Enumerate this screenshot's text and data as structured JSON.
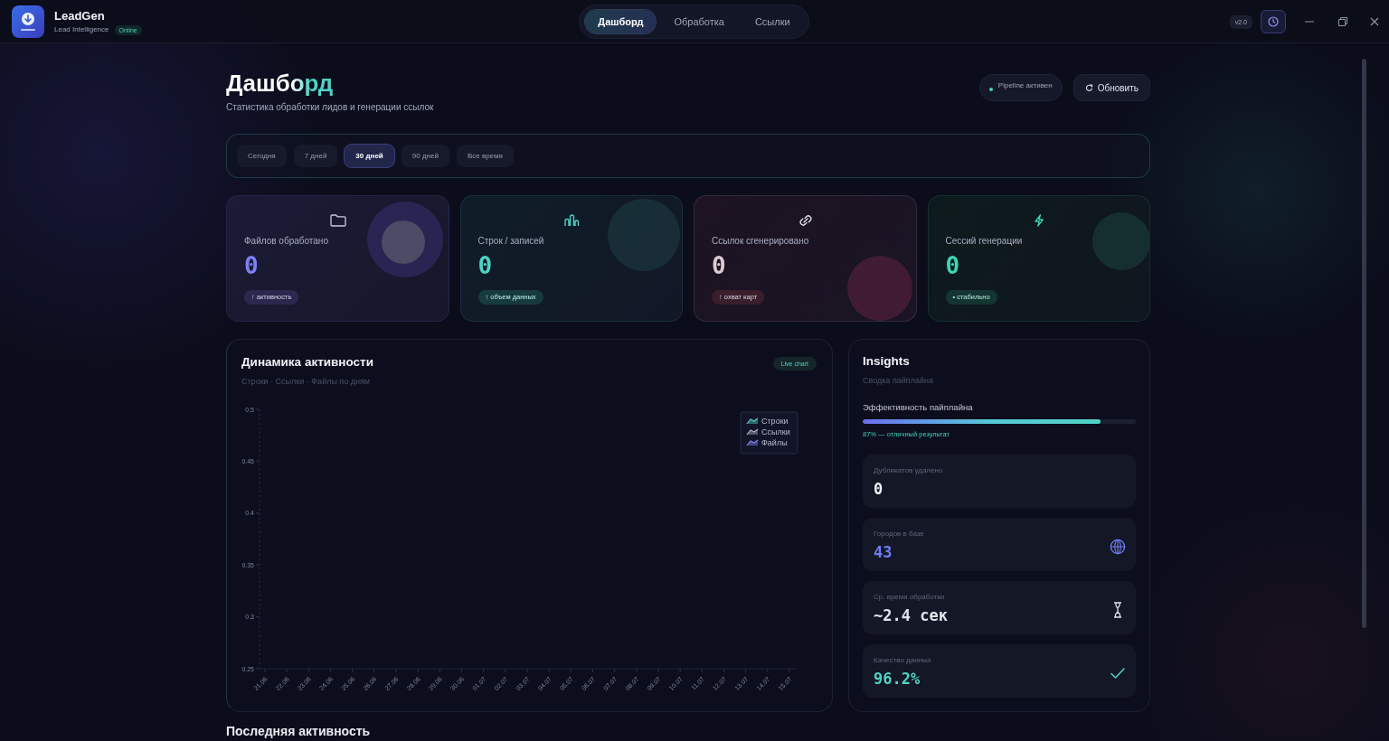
{
  "app": {
    "name": "LeadGen",
    "tagline": "Lead Intelligence",
    "status": "Online",
    "version": "v2.0"
  },
  "nav_tabs": [
    {
      "label": "Дашборд",
      "selected": true
    },
    {
      "label": "Обработка",
      "selected": false
    },
    {
      "label": "Ссылки",
      "selected": false
    }
  ],
  "header": {
    "title": "Дашборд",
    "subtitle": "Статистика обработки лидов и генерации ссылок",
    "pipeline_status": "Pipeline активен",
    "refresh_button": "Обновить"
  },
  "periods": [
    {
      "label": "Сегодня",
      "selected": false
    },
    {
      "label": "7 дней",
      "selected": false
    },
    {
      "label": "30 дней",
      "selected": true
    },
    {
      "label": "90 дней",
      "selected": false
    },
    {
      "label": "Все время",
      "selected": false
    }
  ],
  "stats": [
    {
      "kind": "folder",
      "label": "Файлов обработано",
      "value": "0",
      "badge": "↑ активность",
      "color": "#7c82f4"
    },
    {
      "kind": "bars",
      "label": "Строк / записей",
      "value": "0",
      "badge": "↑ объем данных",
      "color": "#4fd1c5"
    },
    {
      "kind": "link",
      "label": "Ссылок сгенерировано",
      "value": "0",
      "badge": "↑ охват карт",
      "color": "#dccbd5"
    },
    {
      "kind": "bolt",
      "label": "Сессий генерации",
      "value": "0",
      "badge": "• стабильно",
      "color": "#3fd3b4"
    }
  ],
  "chart": {
    "title": "Динамика активности",
    "subtitle": "Строки · Ссылки · Файлы по дням",
    "badge": "Live chart",
    "chart_data": {
      "type": "line",
      "categories": [
        "21.06",
        "22.06",
        "23.06",
        "24.06",
        "25.06",
        "26.06",
        "27.06",
        "28.06",
        "29.06",
        "30.06",
        "01.07",
        "02.07",
        "03.07",
        "04.07",
        "05.07",
        "06.07",
        "07.07",
        "08.07",
        "09.07",
        "10.07",
        "11.07",
        "12.07",
        "13.07",
        "14.07",
        "15.07"
      ],
      "series": [
        {
          "name": "Строки",
          "color": "#4fd1c5",
          "values": [
            null,
            null,
            null,
            null,
            null,
            null,
            null,
            null,
            null,
            null,
            null,
            null,
            null,
            null,
            null,
            null,
            null,
            null,
            null,
            null,
            null,
            null,
            null,
            null,
            null
          ]
        },
        {
          "name": "Ссылки",
          "color": "#b9a9c2",
          "values": [
            null,
            null,
            null,
            null,
            null,
            null,
            null,
            null,
            null,
            null,
            null,
            null,
            null,
            null,
            null,
            null,
            null,
            null,
            null,
            null,
            null,
            null,
            null,
            null,
            null
          ]
        },
        {
          "name": "Файлы",
          "color": "#7c82f4",
          "values": [
            null,
            null,
            null,
            null,
            null,
            null,
            null,
            null,
            null,
            null,
            null,
            null,
            null,
            null,
            null,
            null,
            null,
            null,
            null,
            null,
            null,
            null,
            null,
            null,
            null
          ]
        }
      ],
      "ylim": [
        0.25,
        0.5
      ],
      "yticks": [
        0.5,
        0.45,
        0.4,
        0.35,
        0.3,
        0.25
      ]
    }
  },
  "insights": {
    "title": "Insights",
    "subtitle": "Сводка пайплайна",
    "efficiency": {
      "label": "Эффективность пайплайна",
      "level": 0.87,
      "caption": "87% — отличный результат"
    },
    "metrics": [
      {
        "kind": "plain",
        "label": "Дубликатов удалено",
        "value": "0",
        "color": "#f2f2f6"
      },
      {
        "kind": "globe",
        "label": "Городов в базе",
        "value": "43",
        "color": "#6f7cf6"
      },
      {
        "kind": "timer",
        "label": "Ср. время обработки",
        "value": "~2.4 сек",
        "color": "#e4e4ec"
      },
      {
        "kind": "check",
        "label": "Качество данных",
        "value": "96.2%",
        "color": "#4fd1c5"
      }
    ]
  },
  "recent": {
    "title": "Последняя активность"
  }
}
